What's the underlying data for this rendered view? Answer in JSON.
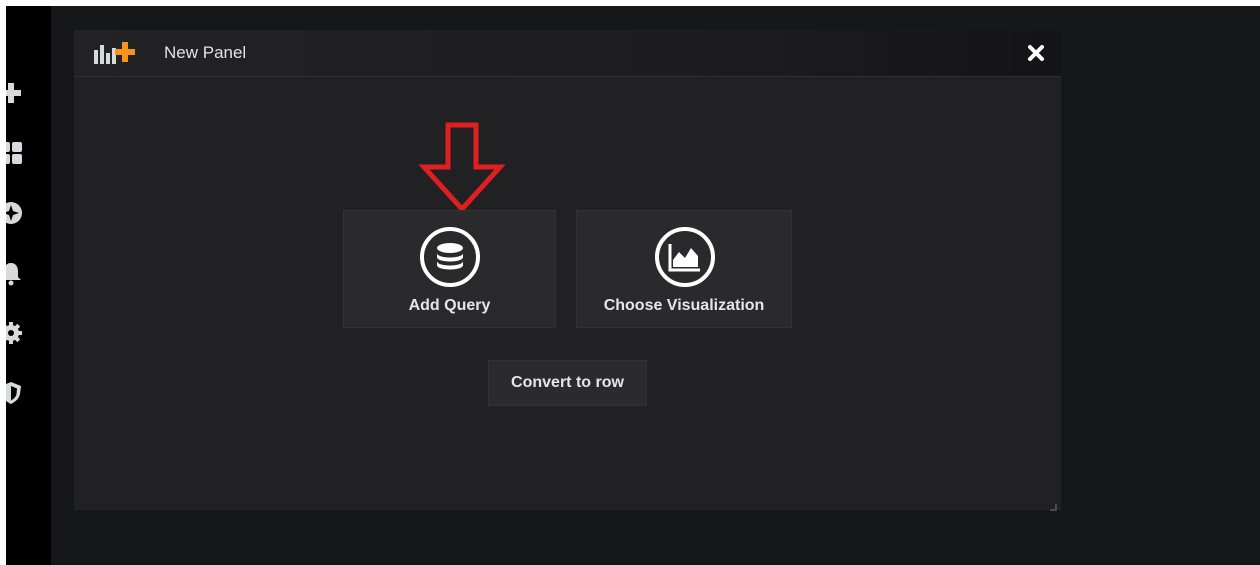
{
  "sidemenu": {
    "icons": [
      "plus-icon",
      "dashboards-icon",
      "explore-icon",
      "alerting-icon",
      "configuration-icon",
      "server-admin-icon"
    ]
  },
  "panel": {
    "title": "New Panel",
    "logo_icon": "panel-add-logo-icon",
    "close_icon": "close-icon",
    "accent_color": "#f7941d",
    "background_color": "#212124"
  },
  "actions": {
    "add_query": {
      "label": "Add Query",
      "icon": "database-icon"
    },
    "choose_visualization": {
      "label": "Choose Visualization",
      "icon": "area-chart-icon"
    },
    "convert_to_row": {
      "label": "Convert to row"
    }
  },
  "annotation": {
    "arrow_icon": "red-arrow-down-icon",
    "arrow_color": "#e02020"
  }
}
